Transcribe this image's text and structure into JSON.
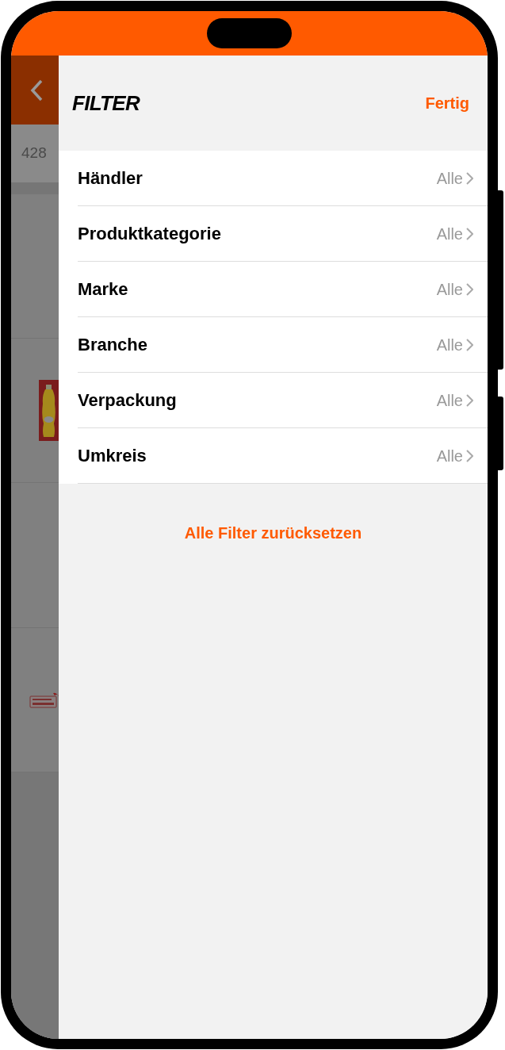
{
  "background": {
    "count_text": "428"
  },
  "drawer": {
    "title": "FILTER",
    "done_button": "Fertig",
    "filters": [
      {
        "label": "Händler",
        "value": "Alle"
      },
      {
        "label": "Produktkategorie",
        "value": "Alle"
      },
      {
        "label": "Marke",
        "value": "Alle"
      },
      {
        "label": "Branche",
        "value": "Alle"
      },
      {
        "label": "Verpackung",
        "value": "Alle"
      },
      {
        "label": "Umkreis",
        "value": "Alle"
      }
    ],
    "reset_button": "Alle Filter zurücksetzen"
  }
}
